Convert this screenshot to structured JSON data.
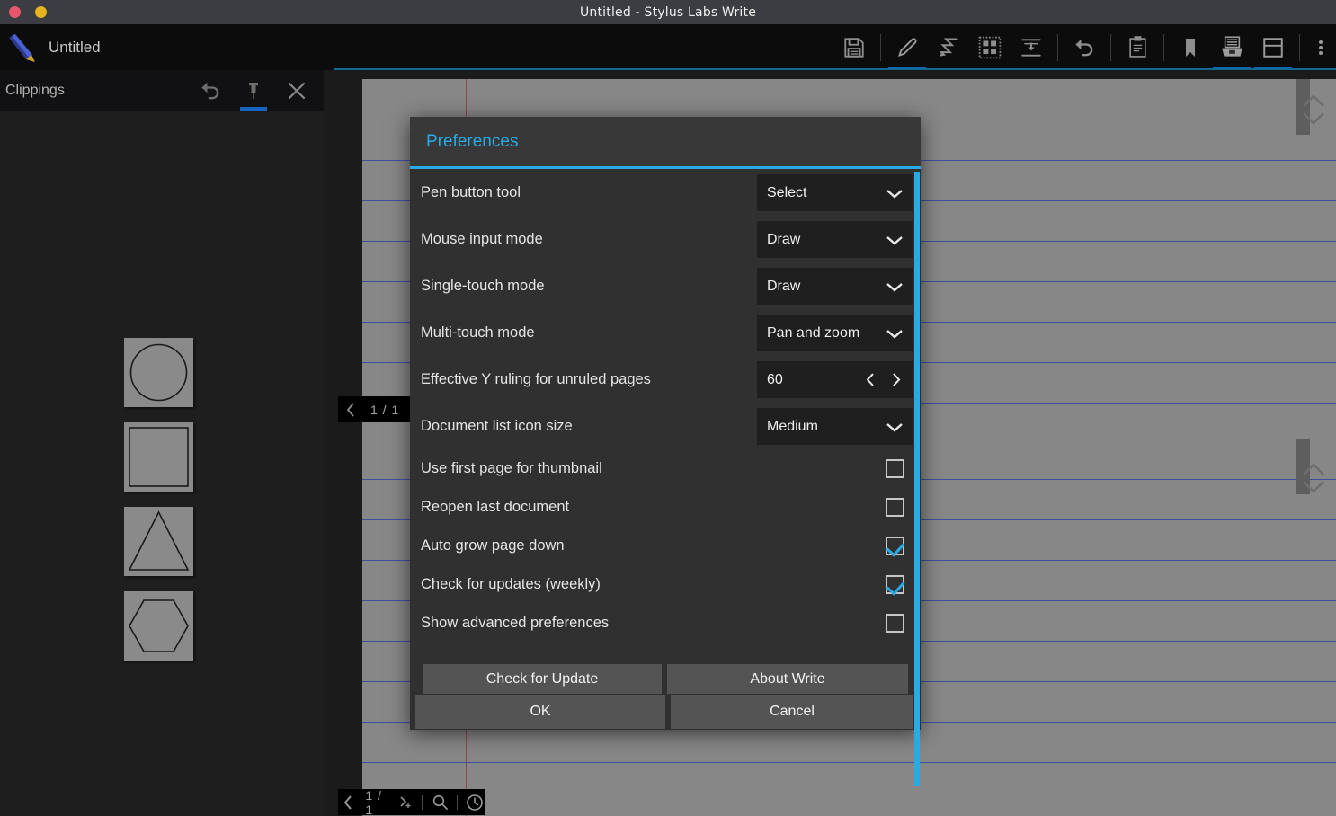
{
  "window": {
    "title": "Untitled - Stylus Labs Write",
    "controls": [
      "close",
      "minimize"
    ]
  },
  "app_toolbar": {
    "document_name": "Untitled",
    "logo_icon": "pencil-logo-icon",
    "buttons": [
      {
        "name": "save-icon",
        "label": "Save",
        "active": false
      },
      {
        "name": "pen-tool-icon",
        "label": "Pen",
        "active": true
      },
      {
        "name": "eraser-tool-icon",
        "label": "Eraser",
        "active": false
      },
      {
        "name": "select-tool-icon",
        "label": "Select",
        "active": false
      },
      {
        "name": "insert-space-icon",
        "label": "Insert space",
        "active": false
      },
      {
        "name": "undo-icon",
        "label": "Undo",
        "active": false
      },
      {
        "name": "clipboard-icon",
        "label": "Clipboard",
        "active": false
      },
      {
        "name": "bookmark-icon",
        "label": "Bookmark",
        "active": false
      },
      {
        "name": "clippings-icon",
        "label": "Clippings",
        "active": true
      },
      {
        "name": "pages-icon",
        "label": "Pages",
        "active": true
      },
      {
        "name": "overflow-menu-icon",
        "label": "More",
        "active": false
      }
    ]
  },
  "clippings_panel": {
    "title": "Clippings",
    "tools": [
      {
        "name": "undo-icon",
        "label": "Undo",
        "active": false
      },
      {
        "name": "pin-icon",
        "label": "Pin",
        "active": true
      },
      {
        "name": "close-icon",
        "label": "Close",
        "active": false
      }
    ],
    "items": [
      {
        "name": "clipping-circle",
        "shape": "circle"
      },
      {
        "name": "clipping-square",
        "shape": "square"
      },
      {
        "name": "clipping-triangle",
        "shape": "triangle"
      },
      {
        "name": "clipping-hexagon",
        "shape": "hexagon"
      }
    ]
  },
  "canvas": {
    "page_top": {
      "page_indicator": "1 / 1",
      "prev_label": "‹",
      "next_label": "›"
    },
    "page_bottom": {
      "page_indicator": "1 / 1",
      "prev_label": "‹",
      "next_add_label": "next-page-add",
      "search_icon": "search-icon",
      "history_icon": "clock-icon"
    }
  },
  "dialog": {
    "title": "Preferences",
    "accent_color": "#29aae2",
    "selects": [
      {
        "label": "Pen button tool",
        "value": "Select"
      },
      {
        "label": "Mouse input mode",
        "value": "Draw"
      },
      {
        "label": "Single-touch mode",
        "value": "Draw"
      },
      {
        "label": "Multi-touch mode",
        "value": "Pan and zoom"
      }
    ],
    "spinner": {
      "label": "Effective Y ruling for unruled pages",
      "value": "60"
    },
    "select_after_spinner": {
      "label": "Document list icon size",
      "value": "Medium"
    },
    "checkboxes": [
      {
        "label": "Use first page for thumbnail",
        "checked": false
      },
      {
        "label": "Reopen last document",
        "checked": false
      },
      {
        "label": "Auto grow page down",
        "checked": true
      },
      {
        "label": "Check for updates (weekly)",
        "checked": true
      },
      {
        "label": "Show advanced preferences",
        "checked": false
      }
    ],
    "buttons": {
      "check_update": "Check for Update",
      "about": "About Write",
      "ok": "OK",
      "cancel": "Cancel"
    }
  }
}
